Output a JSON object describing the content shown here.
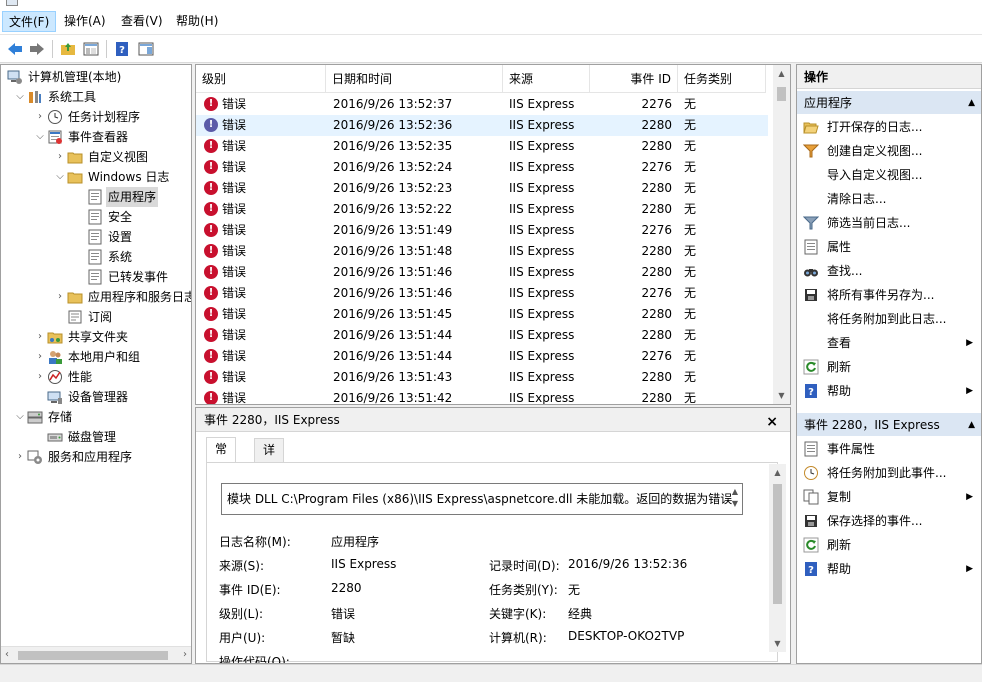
{
  "menu": [
    "文件(F)",
    "操作(A)",
    "查看(V)",
    "帮助(H)"
  ],
  "tree": [
    {
      "label": "计算机管理(本地)",
      "icon": "computer-mgmt-icon",
      "level": 0,
      "arrow": ""
    },
    {
      "label": "系统工具",
      "icon": "tools-icon",
      "level": 1,
      "arrow": "v"
    },
    {
      "label": "任务计划程序",
      "icon": "clock-icon",
      "level": 2,
      "arrow": ">"
    },
    {
      "label": "事件查看器",
      "icon": "event-viewer-icon",
      "level": 2,
      "arrow": "v"
    },
    {
      "label": "自定义视图",
      "icon": "folder-icon",
      "level": 3,
      "arrow": ">"
    },
    {
      "label": "Windows 日志",
      "icon": "folder-icon",
      "level": 3,
      "arrow": "v"
    },
    {
      "label": "应用程序",
      "icon": "log-icon",
      "level": 4,
      "arrow": ""
    },
    {
      "label": "安全",
      "icon": "log-icon",
      "level": 4,
      "arrow": ""
    },
    {
      "label": "设置",
      "icon": "log-icon",
      "level": 4,
      "arrow": ""
    },
    {
      "label": "系统",
      "icon": "log-icon",
      "level": 4,
      "arrow": ""
    },
    {
      "label": "已转发事件",
      "icon": "log-icon",
      "level": 4,
      "arrow": ""
    },
    {
      "label": "应用程序和服务日志",
      "icon": "folder-icon",
      "level": 3,
      "arrow": ">"
    },
    {
      "label": "订阅",
      "icon": "subscription-icon",
      "level": 3,
      "arrow": ""
    },
    {
      "label": "共享文件夹",
      "icon": "share-icon",
      "level": 2,
      "arrow": ">"
    },
    {
      "label": "本地用户和组",
      "icon": "users-icon",
      "level": 2,
      "arrow": ">"
    },
    {
      "label": "性能",
      "icon": "performance-icon",
      "level": 2,
      "arrow": ">"
    },
    {
      "label": "设备管理器",
      "icon": "device-icon",
      "level": 2,
      "arrow": ""
    },
    {
      "label": "存储",
      "icon": "storage-icon",
      "level": 1,
      "arrow": "v"
    },
    {
      "label": "磁盘管理",
      "icon": "disk-icon",
      "level": 2,
      "arrow": ""
    },
    {
      "label": "服务和应用程序",
      "icon": "services-icon",
      "level": 1,
      "arrow": ">"
    }
  ],
  "list": {
    "columns": [
      "级别",
      "日期和时间",
      "来源",
      "事件 ID",
      "任务类别"
    ],
    "rows": [
      [
        "错误",
        "2016/9/26 13:52:37",
        "IIS Express",
        "2276",
        "无"
      ],
      [
        "错误",
        "2016/9/26 13:52:36",
        "IIS Express",
        "2280",
        "无"
      ],
      [
        "错误",
        "2016/9/26 13:52:35",
        "IIS Express",
        "2280",
        "无"
      ],
      [
        "错误",
        "2016/9/26 13:52:24",
        "IIS Express",
        "2276",
        "无"
      ],
      [
        "错误",
        "2016/9/26 13:52:23",
        "IIS Express",
        "2280",
        "无"
      ],
      [
        "错误",
        "2016/9/26 13:52:22",
        "IIS Express",
        "2280",
        "无"
      ],
      [
        "错误",
        "2016/9/26 13:51:49",
        "IIS Express",
        "2276",
        "无"
      ],
      [
        "错误",
        "2016/9/26 13:51:48",
        "IIS Express",
        "2280",
        "无"
      ],
      [
        "错误",
        "2016/9/26 13:51:46",
        "IIS Express",
        "2280",
        "无"
      ],
      [
        "错误",
        "2016/9/26 13:51:46",
        "IIS Express",
        "2276",
        "无"
      ],
      [
        "错误",
        "2016/9/26 13:51:45",
        "IIS Express",
        "2280",
        "无"
      ],
      [
        "错误",
        "2016/9/26 13:51:44",
        "IIS Express",
        "2280",
        "无"
      ],
      [
        "错误",
        "2016/9/26 13:51:44",
        "IIS Express",
        "2276",
        "无"
      ],
      [
        "错误",
        "2016/9/26 13:51:43",
        "IIS Express",
        "2280",
        "无"
      ],
      [
        "错误",
        "2016/9/26 13:51:42",
        "IIS Express",
        "2280",
        "无"
      ]
    ]
  },
  "detail": {
    "title": "事件 2280，IIS Express",
    "close": "×",
    "tabs": [
      "常规",
      "详细信息"
    ],
    "description": "模块 DLL C:\\Program Files (x86)\\IIS Express\\aspnetcore.dll 未能加载。返回的数据为错误",
    "fields": {
      "log_name_label": "日志名称(M):",
      "log_name": "应用程序",
      "source_label": "来源(S):",
      "source": "IIS Express",
      "logged_label": "记录时间(D):",
      "logged": "2016/9/26 13:52:36",
      "event_id_label": "事件 ID(E):",
      "event_id": "2280",
      "task_label": "任务类别(Y):",
      "task": "无",
      "level_label": "级别(L):",
      "level": "错误",
      "keywords_label": "关键字(K):",
      "keywords": "经典",
      "user_label": "用户(U):",
      "user": "暂缺",
      "computer_label": "计算机(R):",
      "computer": "DESKTOP-OKO2TVP",
      "opcode_label": "操作代码(O):"
    }
  },
  "actions": {
    "header": "操作",
    "section1": "应用程序",
    "items1": [
      {
        "label": "打开保存的日志...",
        "icon": "folder-open-icon",
        "sub": false
      },
      {
        "label": "创建自定义视图...",
        "icon": "filter-create-icon",
        "sub": false
      },
      {
        "label": "导入自定义视图...",
        "icon": "",
        "sub": false
      },
      {
        "label": "清除日志...",
        "icon": "",
        "sub": false
      },
      {
        "label": "筛选当前日志...",
        "icon": "filter-icon",
        "sub": false
      },
      {
        "label": "属性",
        "icon": "properties-icon",
        "sub": false
      },
      {
        "label": "查找...",
        "icon": "binoculars-icon",
        "sub": false
      },
      {
        "label": "将所有事件另存为...",
        "icon": "save-icon",
        "sub": false
      },
      {
        "label": "将任务附加到此日志...",
        "icon": "",
        "sub": false
      },
      {
        "label": "查看",
        "icon": "",
        "sub": true
      },
      {
        "label": "刷新",
        "icon": "refresh-icon",
        "sub": false
      },
      {
        "label": "帮助",
        "icon": "help-icon",
        "sub": true
      }
    ],
    "section2": "事件 2280，IIS Express",
    "items2": [
      {
        "label": "事件属性",
        "icon": "properties-icon",
        "sub": false
      },
      {
        "label": "将任务附加到此事件...",
        "icon": "task-icon",
        "sub": false
      },
      {
        "label": "复制",
        "icon": "copy-icon",
        "sub": true
      },
      {
        "label": "保存选择的事件...",
        "icon": "save-icon",
        "sub": false
      },
      {
        "label": "刷新",
        "icon": "refresh-icon",
        "sub": false
      },
      {
        "label": "帮助",
        "icon": "help-icon",
        "sub": true
      }
    ]
  }
}
